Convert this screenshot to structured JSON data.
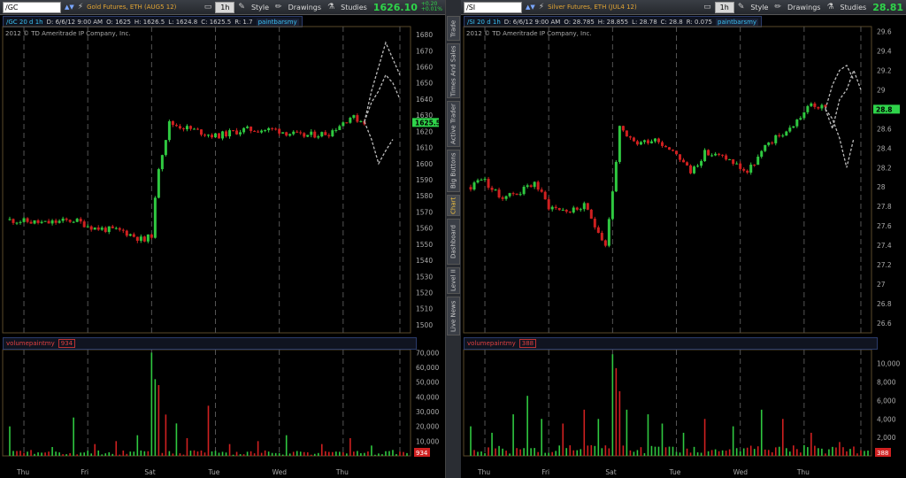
{
  "toolbar": {
    "style_label": "Style",
    "drawings_label": "Drawings",
    "studies_label": "Studies"
  },
  "sidebar_tabs": [
    {
      "label": "Trade",
      "active": false
    },
    {
      "label": "Times And Sales",
      "active": false
    },
    {
      "label": "Active Trader",
      "active": false
    },
    {
      "label": "Big Buttons",
      "active": false
    },
    {
      "label": "Chart",
      "active": true
    },
    {
      "label": "Dashboard",
      "active": false
    },
    {
      "label": "Level II",
      "active": false
    },
    {
      "label": "Live News",
      "active": false
    }
  ],
  "colors": {
    "up": "#2fc840",
    "down": "#d02020",
    "projection": "#bbbbbb",
    "grid": "#555555",
    "price_tag": "#2fd44a"
  },
  "panels": [
    {
      "symbol": "/GC",
      "description": "Gold Futures, ETH (AUG5 12)",
      "timeframe": "1h",
      "price": "1626.10",
      "change": "+0.20",
      "change_pct": "+0.01%",
      "info": {
        "symbol_period": "/GC 20 d 1h",
        "date": "D: 6/6/12 9:00 AM",
        "open": "O: 1625",
        "high": "H: 1626.5",
        "low": "L: 1624.8",
        "close": "C: 1625.5",
        "range": "R: 1.7",
        "study": "paintbarsmy"
      },
      "copyright": "2012 © TD Ameritrade IP Company, Inc.",
      "current_price_tag": "1625.5",
      "volume_study": "volumepaintmy",
      "volume_value": "934"
    },
    {
      "symbol": "/SI",
      "description": "Silver Futures, ETH (JUL4 12)",
      "timeframe": "1h",
      "price": "28.81",
      "change": "",
      "change_pct": "",
      "info": {
        "symbol_period": "/SI 20 d 1h",
        "date": "D: 6/6/12 9:00 AM",
        "open": "O: 28.785",
        "high": "H: 28.855",
        "low": "L: 28.78",
        "close": "C: 28.8",
        "range": "R: 0.075",
        "study": "paintbarsmy"
      },
      "copyright": "2012 © TD Ameritrade IP Company, Inc.",
      "current_price_tag": "28.8",
      "volume_study": "volumepaintmy",
      "volume_value": "388"
    }
  ],
  "chart_data": [
    {
      "type": "candlestick",
      "symbol": "/GC",
      "x_tick_labels": [
        "Thu",
        "Fri",
        "Sat",
        "Tue",
        "Wed",
        "Thu"
      ],
      "y_ticks": [
        1500,
        1510,
        1520,
        1530,
        1540,
        1550,
        1560,
        1570,
        1580,
        1590,
        1600,
        1610,
        1620,
        1630,
        1640,
        1650,
        1660,
        1670,
        1680
      ],
      "ylim": [
        1495,
        1685
      ],
      "bars_count": 112,
      "close_anchors": [
        [
          0,
          1565
        ],
        [
          10,
          1563
        ],
        [
          18,
          1565
        ],
        [
          24,
          1560
        ],
        [
          32,
          1558
        ],
        [
          38,
          1552
        ],
        [
          40,
          1556
        ],
        [
          42,
          1598
        ],
        [
          45,
          1625
        ],
        [
          50,
          1622
        ],
        [
          58,
          1617
        ],
        [
          66,
          1621
        ],
        [
          75,
          1621
        ],
        [
          82,
          1617
        ],
        [
          90,
          1619
        ],
        [
          96,
          1629
        ],
        [
          100,
          1626
        ]
      ],
      "projections": [
        [
          [
            100,
            1626
          ],
          [
            102,
            1638
          ],
          [
            104,
            1645
          ],
          [
            106,
            1655
          ],
          [
            108,
            1650
          ],
          [
            110,
            1640
          ]
        ],
        [
          [
            100,
            1626
          ],
          [
            102,
            1645
          ],
          [
            104,
            1660
          ],
          [
            106,
            1675
          ],
          [
            108,
            1665
          ],
          [
            110,
            1655
          ]
        ],
        [
          [
            100,
            1626
          ],
          [
            102,
            1615
          ],
          [
            104,
            1600
          ],
          [
            106,
            1608
          ],
          [
            108,
            1615
          ]
        ]
      ],
      "volume": {
        "y_ticks": [
          10000,
          20000,
          30000,
          40000,
          50000,
          60000,
          70000
        ],
        "ymax": 72000,
        "spikes": [
          [
            0,
            20000
          ],
          [
            6,
            4000
          ],
          [
            12,
            6000
          ],
          [
            18,
            26000
          ],
          [
            24,
            8000
          ],
          [
            30,
            10000
          ],
          [
            36,
            14000
          ],
          [
            40,
            70000
          ],
          [
            41,
            52000
          ],
          [
            42,
            48000
          ],
          [
            44,
            28000
          ],
          [
            47,
            22000
          ],
          [
            50,
            12000
          ],
          [
            56,
            34000
          ],
          [
            62,
            8000
          ],
          [
            70,
            10000
          ],
          [
            78,
            14000
          ],
          [
            88,
            8000
          ],
          [
            96,
            12000
          ],
          [
            102,
            7000
          ],
          [
            108,
            4000
          ]
        ],
        "base": 2500
      }
    },
    {
      "type": "candlestick",
      "symbol": "/SI",
      "x_tick_labels": [
        "Thu",
        "Fri",
        "Sat",
        "Tue",
        "Wed",
        "Thu"
      ],
      "y_ticks": [
        26.6,
        26.8,
        27,
        27.2,
        27.4,
        27.6,
        27.8,
        28,
        28.2,
        28.4,
        28.6,
        28.8,
        29,
        29.2,
        29.4,
        29.6
      ],
      "ylim": [
        26.5,
        29.65
      ],
      "bars_count": 112,
      "close_anchors": [
        [
          0,
          28.0
        ],
        [
          3,
          28.1
        ],
        [
          8,
          27.9
        ],
        [
          14,
          27.95
        ],
        [
          18,
          28.05
        ],
        [
          22,
          27.8
        ],
        [
          28,
          27.75
        ],
        [
          32,
          27.8
        ],
        [
          36,
          27.55
        ],
        [
          38,
          27.4
        ],
        [
          40,
          27.95
        ],
        [
          42,
          28.6
        ],
        [
          44,
          28.5
        ],
        [
          47,
          28.45
        ],
        [
          52,
          28.5
        ],
        [
          58,
          28.35
        ],
        [
          62,
          28.15
        ],
        [
          66,
          28.35
        ],
        [
          72,
          28.3
        ],
        [
          78,
          28.15
        ],
        [
          84,
          28.45
        ],
        [
          90,
          28.6
        ],
        [
          96,
          28.85
        ],
        [
          100,
          28.8
        ]
      ],
      "projections": [
        [
          [
            100,
            28.8
          ],
          [
            102,
            28.6
          ],
          [
            104,
            28.9
          ],
          [
            106,
            29.0
          ],
          [
            108,
            29.2
          ],
          [
            110,
            29.0
          ]
        ],
        [
          [
            100,
            28.8
          ],
          [
            102,
            28.7
          ],
          [
            104,
            28.5
          ],
          [
            106,
            28.2
          ],
          [
            108,
            28.5
          ]
        ],
        [
          [
            100,
            28.8
          ],
          [
            102,
            29.05
          ],
          [
            104,
            29.2
          ],
          [
            106,
            29.25
          ],
          [
            108,
            29.1
          ]
        ]
      ],
      "volume": {
        "y_ticks": [
          2000,
          4000,
          6000,
          8000,
          10000
        ],
        "ymax": 11500,
        "spikes": [
          [
            0,
            3200
          ],
          [
            6,
            2500
          ],
          [
            12,
            4500
          ],
          [
            16,
            6500
          ],
          [
            20,
            4000
          ],
          [
            26,
            3500
          ],
          [
            32,
            5000
          ],
          [
            36,
            4000
          ],
          [
            40,
            11000
          ],
          [
            41,
            9500
          ],
          [
            42,
            7000
          ],
          [
            44,
            5000
          ],
          [
            50,
            4500
          ],
          [
            54,
            3500
          ],
          [
            60,
            2500
          ],
          [
            66,
            4000
          ],
          [
            74,
            3200
          ],
          [
            82,
            5000
          ],
          [
            88,
            4000
          ],
          [
            96,
            2500
          ],
          [
            104,
            1500
          ]
        ],
        "base": 800
      }
    }
  ]
}
